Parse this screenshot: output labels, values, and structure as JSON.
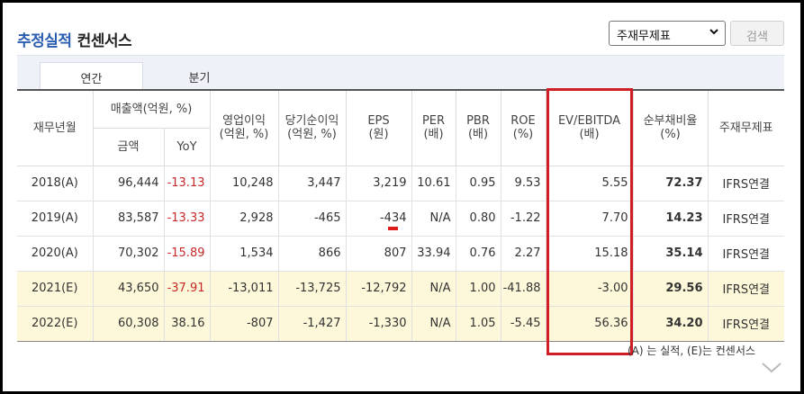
{
  "header": {
    "title_blue": "추정실적",
    "title_dark": "컨센서스"
  },
  "controls": {
    "select_value": "주재무제표",
    "search_label": "검색"
  },
  "tabs": [
    {
      "label": "연간"
    },
    {
      "label": "분기"
    }
  ],
  "table": {
    "headers": {
      "period": "재무년월",
      "sales_group": "매출액(억원, %)",
      "sales_amount": "금액",
      "sales_yoy": "YoY",
      "op_income_1": "영업이익",
      "op_income_2": "(억원, %)",
      "net_income_1": "당기순이익",
      "net_income_2": "(억원, %)",
      "eps_1": "EPS",
      "eps_2": "(원)",
      "per_1": "PER",
      "per_2": "(배)",
      "pbr_1": "PBR",
      "pbr_2": "(배)",
      "roe_1": "ROE",
      "roe_2": "(%)",
      "ev_1": "EV/EBITDA",
      "ev_2": "(배)",
      "debt_1": "순부채비율",
      "debt_2": "(%)",
      "main_fs": "주재무제표"
    },
    "rows": [
      {
        "period": "2018(A)",
        "sales": "96,444",
        "yoy": "-13.13",
        "op": "10,248",
        "net": "3,447",
        "eps": "3,219",
        "per": "10.61",
        "pbr": "0.95",
        "roe": "9.53",
        "ev": "5.55",
        "debt": "72.37",
        "fs": "IFRS연결"
      },
      {
        "period": "2019(A)",
        "sales": "83,587",
        "yoy": "-13.33",
        "op": "2,928",
        "net": "-465",
        "eps": "-434",
        "per": "N/A",
        "pbr": "0.80",
        "roe": "-1.22",
        "ev": "7.70",
        "debt": "14.23",
        "fs": "IFRS연결"
      },
      {
        "period": "2020(A)",
        "sales": "70,302",
        "yoy": "-15.89",
        "op": "1,534",
        "net": "866",
        "eps": "807",
        "per": "33.94",
        "pbr": "0.76",
        "roe": "2.27",
        "ev": "15.18",
        "debt": "35.14",
        "fs": "IFRS연결"
      },
      {
        "period": "2021(E)",
        "sales": "43,650",
        "yoy": "-37.91",
        "op": "-13,011",
        "net": "-13,725",
        "eps": "-12,792",
        "per": "N/A",
        "pbr": "1.00",
        "roe": "-41.88",
        "ev": "-3.00",
        "debt": "29.56",
        "fs": "IFRS연결"
      },
      {
        "period": "2022(E)",
        "sales": "60,308",
        "yoy": "38.16",
        "op": "-807",
        "net": "-1,427",
        "eps": "-1,330",
        "per": "N/A",
        "pbr": "1.05",
        "roe": "-5.45",
        "ev": "56.36",
        "debt": "34.20",
        "fs": "IFRS연결"
      }
    ]
  },
  "note": "(A) 는 실적, (E)는 컨센서스",
  "colors": {
    "accent_blue": "#2a5db0",
    "negative_red": "#c62828",
    "highlight_box": "#d11e24",
    "estimate_row_bg": "#fdf8d9"
  },
  "icons": {
    "select_chevron": "chevron-down-icon",
    "scroll_down": "chevron-down-icon"
  }
}
